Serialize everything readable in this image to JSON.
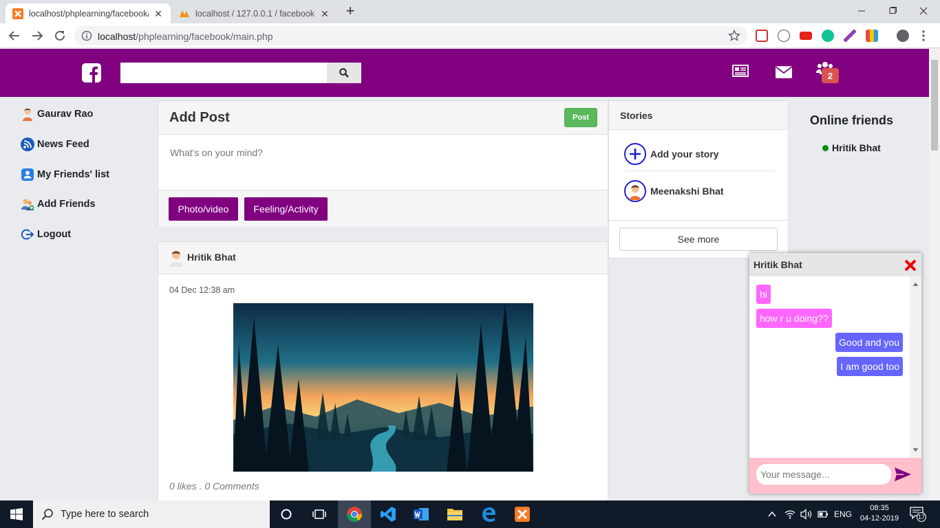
{
  "browser": {
    "tabs": [
      {
        "title": "localhost/phplearning/facebook/",
        "active": true
      },
      {
        "title": "localhost / 127.0.0.1 / facebook /",
        "active": false
      }
    ],
    "url_host": "localhost",
    "url_path": "/phplearning/facebook/main.php"
  },
  "header": {
    "search_placeholder": "",
    "friend_requests_count": "2",
    "brand_color": "#800080"
  },
  "sidebar": {
    "items": [
      {
        "label": "Gaurav Rao",
        "icon": "user-avatar-icon"
      },
      {
        "label": "News Feed",
        "icon": "rss-feed-icon"
      },
      {
        "label": "My Friends' list",
        "icon": "friends-list-icon"
      },
      {
        "label": "Add Friends",
        "icon": "add-friends-icon"
      },
      {
        "label": "Logout",
        "icon": "logout-icon"
      }
    ]
  },
  "add_post": {
    "title": "Add Post",
    "post_button": "Post",
    "placeholder": "What's on your mind?",
    "photo_button": "Photo/video",
    "feeling_button": "Feeling/Activity"
  },
  "post": {
    "author": "Hritik Bhat",
    "date": "04 Dec 12:38 am",
    "stats": "0 likes . 0 Comments",
    "image_alt": "forest-sunset-illustration"
  },
  "stories": {
    "title": "Stories",
    "add_label": "Add your story",
    "items": [
      {
        "name": "Meenakshi Bhat"
      }
    ],
    "see_more": "See more"
  },
  "online": {
    "title": "Online friends",
    "friends": [
      {
        "name": "Hritik Bhat",
        "status_color": "#0a8a0a"
      }
    ]
  },
  "chat": {
    "with": "Hritik Bhat",
    "messages": [
      {
        "text": "hi",
        "dir": "in"
      },
      {
        "text": "how r u doing??",
        "dir": "in"
      },
      {
        "text": "Good and you",
        "dir": "out"
      },
      {
        "text": "I am good too",
        "dir": "out"
      }
    ],
    "input_placeholder": "Your message...",
    "in_color": "#ff66ff",
    "out_color": "#6666ff"
  },
  "taskbar": {
    "search_placeholder": "Type here to search",
    "language": "ENG",
    "time": "08:35",
    "date": "04-12-2019",
    "notifications": "17"
  }
}
